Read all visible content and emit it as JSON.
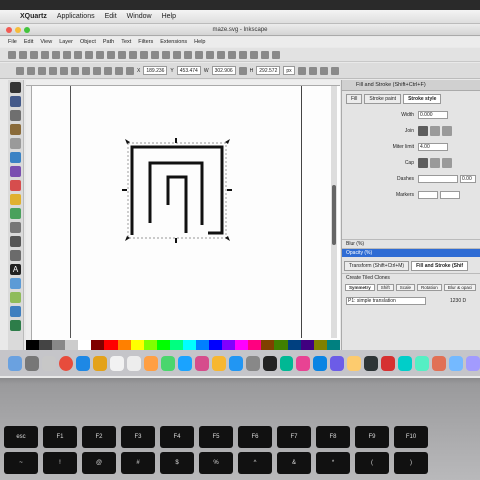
{
  "mac_menubar": {
    "app_name": "XQuartz",
    "items": [
      "Applications",
      "Edit",
      "Window",
      "Help"
    ]
  },
  "window": {
    "title": "maze.svg - Inkscape"
  },
  "inkscape_menu": [
    "File",
    "Edit",
    "View",
    "Layer",
    "Object",
    "Path",
    "Text",
    "Filters",
    "Extensions",
    "Help"
  ],
  "controls": {
    "x_label": "X",
    "x_value": "189.236",
    "y_label": "Y",
    "y_value": "453.474",
    "w_label": "W",
    "w_value": "302.906",
    "h_label": "H",
    "h_value": "292.572",
    "unit": "px"
  },
  "fill_stroke": {
    "panel_title": "Fill and Stroke (Shift+Ctrl+F)",
    "tabs": [
      "Fill",
      "Stroke paint",
      "Stroke style"
    ],
    "active_tab": "Stroke style",
    "width_label": "Width",
    "width_value": "0.000",
    "join_label": "Join",
    "miter_label": "Miter limit",
    "miter_value": "4.00",
    "cap_label": "Cap",
    "dashes_label": "Dashes",
    "dashes_value": "0.00",
    "markers_label": "Markers",
    "blur_label": "Blur (%)",
    "opacity_label": "Opacity (%)"
  },
  "transform": {
    "title": "Transform (Shift+Ctrl+M)",
    "secondary": "Fill and Stroke (Shif",
    "clones_title": "Create Tiled Clones",
    "tabs": [
      "Symmetry",
      "Shift",
      "Scale",
      "Rotation",
      "Blur & opaci"
    ],
    "symmetry_value": "P1: simple translation",
    "extra": "1230 D"
  },
  "colors": {
    "accent": "#2f6cd4",
    "canvas": "#fdfdfd",
    "ui_gray": "#e4e4e4"
  },
  "icons": [
    "selector-icon",
    "node-icon",
    "zoom-icon",
    "rect-icon",
    "circle-icon",
    "star-icon",
    "spiral-icon",
    "pencil-icon",
    "pen-icon",
    "calligraphy-icon",
    "text-icon",
    "gradient-icon",
    "dropper-icon"
  ],
  "keyboard": {
    "row1": [
      "esc",
      "F1",
      "F2",
      "F3",
      "F4",
      "F5",
      "F6",
      "F7",
      "F8",
      "F9",
      "F10"
    ],
    "row2": [
      "~",
      "!",
      "@",
      "#",
      "$",
      "%",
      "^",
      "&",
      "*",
      "(",
      ")"
    ]
  }
}
